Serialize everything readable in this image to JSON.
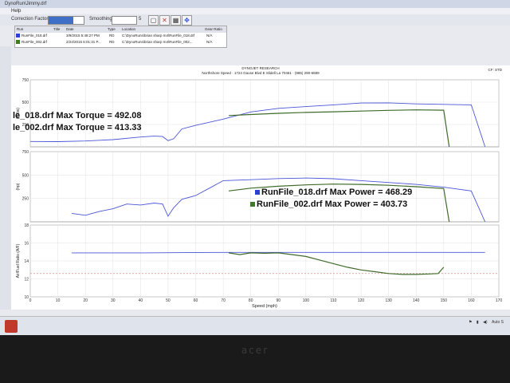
{
  "window": {
    "title": "DynoRun\\Jimmy.drf"
  },
  "menu": {
    "help": "Help"
  },
  "toolbar": {
    "correction_label": "Correction Factor",
    "smoothing_label": "Smoothing",
    "smoothing_value": "5"
  },
  "files": {
    "headers": [
      "Run",
      "Title",
      "Date",
      "Type",
      "Location",
      "Gear Ratio"
    ],
    "rows": [
      {
        "run": "RunFile_018.drf",
        "date": "3/9/2015 5:48:27 PM",
        "type": "RD",
        "location": "C:\\DynoRuns\\brian sharp m4\\RunFile_018.drf",
        "gear": "N/A",
        "color": "#2b3fd6"
      },
      {
        "run": "RunFile_002.drf",
        "date": "2/24/2015 6:01:31 P...",
        "type": "RD",
        "location": "C:\\DynoRuns\\brian sharp m4\\RunFile_002...",
        "gear": "N/A",
        "color": "#3d7a2a"
      }
    ]
  },
  "report": {
    "company": "DYNOJET RESEARCH",
    "shop": "Northshore Speed · 1724 Gause Blvd E Slidell La 70461 · (985) 290-6689",
    "cf": "CF: STD"
  },
  "annotations": {
    "torque_018": "le_018.drf Max Torque = 492.08",
    "torque_002": "le_002.drf Max Torque = 413.33",
    "power_018": "RunFile_018.drf Max Power = 468.29",
    "power_002": "RunFile_002.drf Max Power = 403.73"
  },
  "colors": {
    "run018": "#4a55d6",
    "run002": "#3f6b2a",
    "afr_ref": "#d98b8b"
  },
  "tray": {
    "auto": "Auto S"
  },
  "bezel": {
    "logo": "acer"
  },
  "chart_data": [
    {
      "type": "line",
      "ylabel": "(ft-lbs)",
      "ylim": [
        0,
        750
      ],
      "yticks": [
        250,
        500,
        750
      ],
      "xlim": [
        0,
        170
      ],
      "series": [
        {
          "name": "RunFile_018.drf",
          "x": [
            0,
            10,
            20,
            30,
            40,
            45,
            48,
            50,
            52,
            55,
            60,
            70,
            80,
            90,
            100,
            110,
            120,
            130,
            140,
            150,
            160,
            165
          ],
          "y": [
            60,
            58,
            65,
            80,
            110,
            120,
            115,
            70,
            90,
            200,
            240,
            310,
            390,
            430,
            450,
            470,
            490,
            492,
            480,
            475,
            470,
            0
          ]
        },
        {
          "name": "RunFile_002.drf",
          "x": [
            72,
            80,
            90,
            100,
            110,
            120,
            130,
            140,
            150,
            152
          ],
          "y": [
            350,
            362,
            375,
            385,
            392,
            400,
            408,
            413,
            410,
            0
          ]
        }
      ]
    },
    {
      "type": "line",
      "ylabel": "(hp)",
      "ylim": [
        0,
        750
      ],
      "yticks": [
        250,
        500,
        750
      ],
      "xlim": [
        0,
        170
      ],
      "series": [
        {
          "name": "RunFile_018.drf",
          "x": [
            15,
            20,
            25,
            30,
            35,
            40,
            45,
            48,
            50,
            52,
            55,
            60,
            65,
            70,
            80,
            90,
            100,
            110,
            120,
            130,
            140,
            150,
            160,
            165
          ],
          "y": [
            90,
            70,
            110,
            140,
            190,
            180,
            200,
            190,
            60,
            150,
            240,
            280,
            360,
            440,
            450,
            462,
            468,
            460,
            440,
            420,
            400,
            370,
            330,
            0
          ]
        },
        {
          "name": "RunFile_002.drf",
          "x": [
            72,
            80,
            90,
            100,
            110,
            120,
            130,
            140,
            150,
            152
          ],
          "y": [
            330,
            360,
            380,
            395,
            403,
            400,
            390,
            375,
            355,
            0
          ]
        }
      ]
    },
    {
      "type": "line",
      "ylabel": "Air/Fuel Ratio (A/F)",
      "ylim": [
        10,
        18
      ],
      "yticks": [
        10,
        12,
        14,
        16,
        18
      ],
      "xlim": [
        0,
        170
      ],
      "xticks": [
        0,
        10,
        20,
        30,
        40,
        50,
        60,
        70,
        80,
        90,
        100,
        110,
        120,
        130,
        140,
        150,
        160,
        170
      ],
      "xlabel": "Speed (mph)",
      "series": [
        {
          "name": "RunFile_018.drf",
          "x": [
            15,
            40,
            70,
            100,
            130,
            150,
            165
          ],
          "y": [
            14.9,
            14.9,
            14.95,
            14.95,
            14.95,
            14.95,
            14.95
          ]
        },
        {
          "name": "RunFile_002.drf",
          "x": [
            72,
            76,
            80,
            85,
            90,
            95,
            100,
            105,
            110,
            115,
            120,
            125,
            130,
            135,
            140,
            145,
            148,
            150
          ],
          "y": [
            14.9,
            14.7,
            14.9,
            14.85,
            14.9,
            14.7,
            14.5,
            14.1,
            13.7,
            13.3,
            13.0,
            12.8,
            12.6,
            12.5,
            12.5,
            12.55,
            12.6,
            13.3
          ]
        }
      ],
      "reference_y": 12.6
    }
  ]
}
